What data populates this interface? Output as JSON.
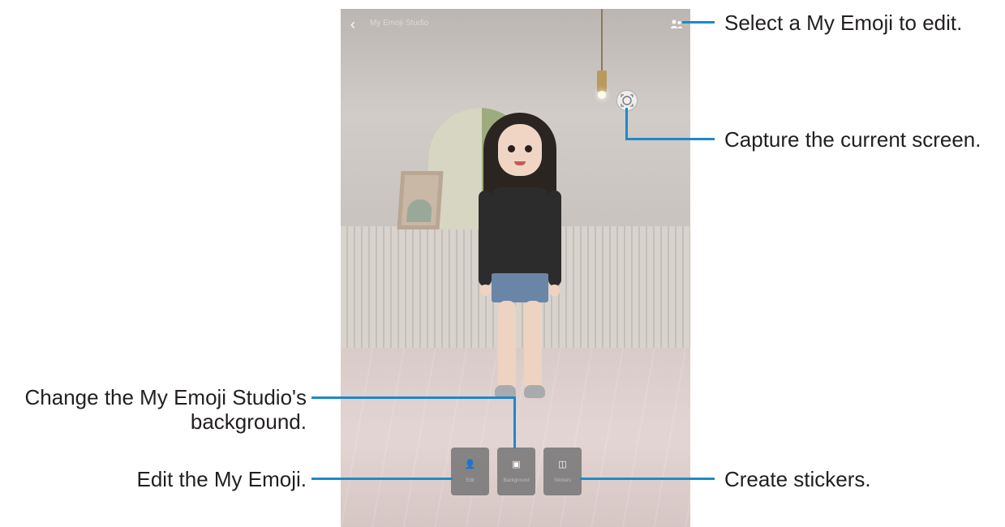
{
  "screen": {
    "title": "My Emoji Studio",
    "back_icon": "back-arrow-icon",
    "select_icon": "people-icon",
    "capture_icon": "camera-capture-icon",
    "tools": [
      {
        "icon": "person-icon",
        "label": "Edit"
      },
      {
        "icon": "image-icon",
        "label": "Background"
      },
      {
        "icon": "sticker-icon",
        "label": "Stickers"
      }
    ]
  },
  "callouts": {
    "select": "Select a My Emoji to edit.",
    "capture": "Capture the current screen.",
    "background_line1": "Change the My Emoji Studio's",
    "background_line2": "background.",
    "edit": "Edit the My Emoji.",
    "stickers": "Create stickers."
  },
  "colors": {
    "callout_line": "#1d8ac8",
    "callout_text": "#231f20"
  }
}
